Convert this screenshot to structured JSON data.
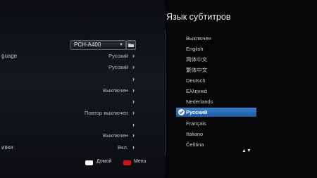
{
  "left": {
    "device_value": "PCH-A400",
    "rows": [
      {
        "label": "guage",
        "value": "Русский"
      },
      {
        "label": "",
        "value": "Русский"
      },
      {
        "label": "",
        "value": ""
      },
      {
        "label": "",
        "value": "Выключен"
      },
      {
        "label": "",
        "value": ""
      },
      {
        "label": "",
        "value": "Повтор выключен"
      },
      {
        "label": "",
        "value": ""
      },
      {
        "label": "",
        "value": "Выключен"
      },
      {
        "label": "ивки",
        "value": "Вкл."
      }
    ]
  },
  "panel": {
    "title": "Язык субтитров",
    "languages": [
      "Выключен",
      "English",
      "简体中文",
      "繁体中文",
      "Deutsch",
      "Ελληνικά",
      "Nederlands",
      "Русский",
      "Français",
      "Italiano",
      "Čeština"
    ],
    "selected_index": 7,
    "selected_color": "#2f72bd"
  },
  "footer": {
    "home_label": "Домой",
    "menu_label": "Menu",
    "menu_key_color": "#d0141a"
  }
}
